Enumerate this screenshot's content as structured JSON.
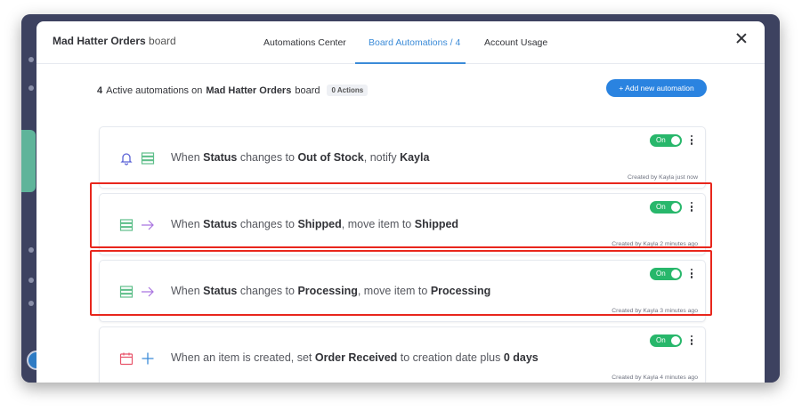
{
  "header": {
    "board_name": "Mad Hatter Orders",
    "board_suffix": " board",
    "tabs": [
      {
        "label": "Automations Center"
      },
      {
        "label": "Board Automations / 4"
      },
      {
        "label": "Account Usage"
      }
    ]
  },
  "summary": {
    "count": "4",
    "text_a": " Active automations on ",
    "board": "Mad Hatter Orders",
    "text_b": " board",
    "actions_badge": "0 Actions"
  },
  "add_button_label": "+ Add new automation",
  "automations": [
    {
      "parts": [
        "When ",
        "Status",
        " changes to ",
        "Out of Stock",
        ", notify ",
        "Kayla",
        "",
        ""
      ],
      "toggle": "On",
      "created": "Created by Kayla just now",
      "icons": [
        "bell-icon",
        "board-icon"
      ]
    },
    {
      "parts": [
        "When ",
        "Status",
        " changes to ",
        "Shipped",
        ", move item to ",
        "Shipped",
        "",
        ""
      ],
      "toggle": "On",
      "created": "Created by Kayla 2 minutes ago",
      "icons": [
        "board-icon",
        "arrow-right-icon"
      ]
    },
    {
      "parts": [
        "When ",
        "Status",
        " changes to ",
        "Processing",
        ", move item to ",
        "Processing",
        "",
        ""
      ],
      "toggle": "On",
      "created": "Created by Kayla 3 minutes ago",
      "icons": [
        "board-icon",
        "arrow-right-icon"
      ]
    },
    {
      "parts": [
        "When an item is created, set ",
        "Order Received",
        " to creation date plus ",
        "0 days",
        "",
        "",
        "",
        ""
      ],
      "toggle": "On",
      "created": "Created by Kayla 4 minutes ago",
      "icons": [
        "calendar-icon",
        "plus-icon"
      ]
    }
  ],
  "colors": {
    "accent": "#2a83e0",
    "toggle_on": "#28b76b",
    "highlight": "#e8261c",
    "board_icon": "#5fbf8a",
    "arrow_icon": "#a974e0"
  }
}
